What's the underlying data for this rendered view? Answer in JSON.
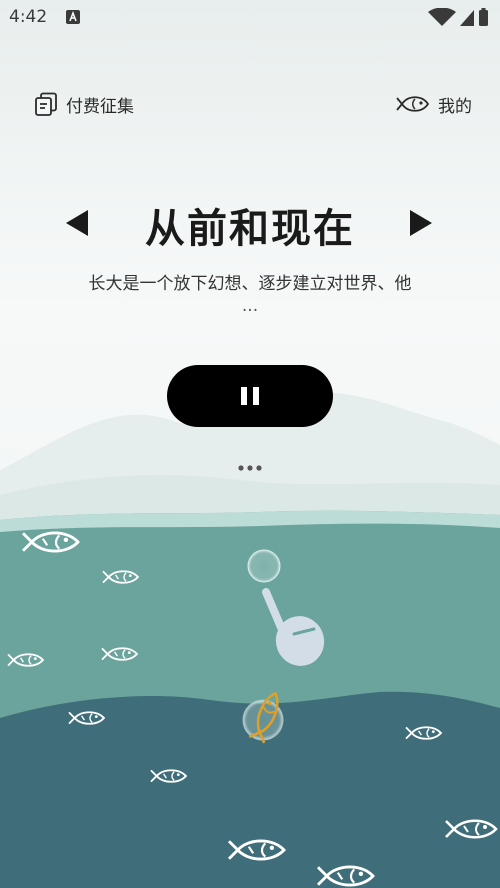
{
  "status_bar": {
    "time": "4:42",
    "icons": [
      "notification-app-icon",
      "wifi-icon",
      "signal-icon",
      "battery-icon"
    ]
  },
  "header": {
    "left_button": {
      "label": "付费征集",
      "icon": "document-stack-icon"
    },
    "right_button": {
      "label": "我的",
      "icon": "fish-outline-icon"
    }
  },
  "track": {
    "title": "从前和现在",
    "description": "长大是一个放下幻想、逐步建立对世界、他",
    "description_more": "..."
  },
  "controls": {
    "prev_icon": "triangle-left-icon",
    "next_icon": "triangle-right-icon",
    "play_state_icon": "pause-icon",
    "more_icon": "more-dots-icon"
  },
  "colors": {
    "sky": "#f2f5f4",
    "mountain": "#e7eeed",
    "water_top": "#6aa49c",
    "water_deep": "#3f6e7a",
    "accent_fish": "#e0a024"
  }
}
